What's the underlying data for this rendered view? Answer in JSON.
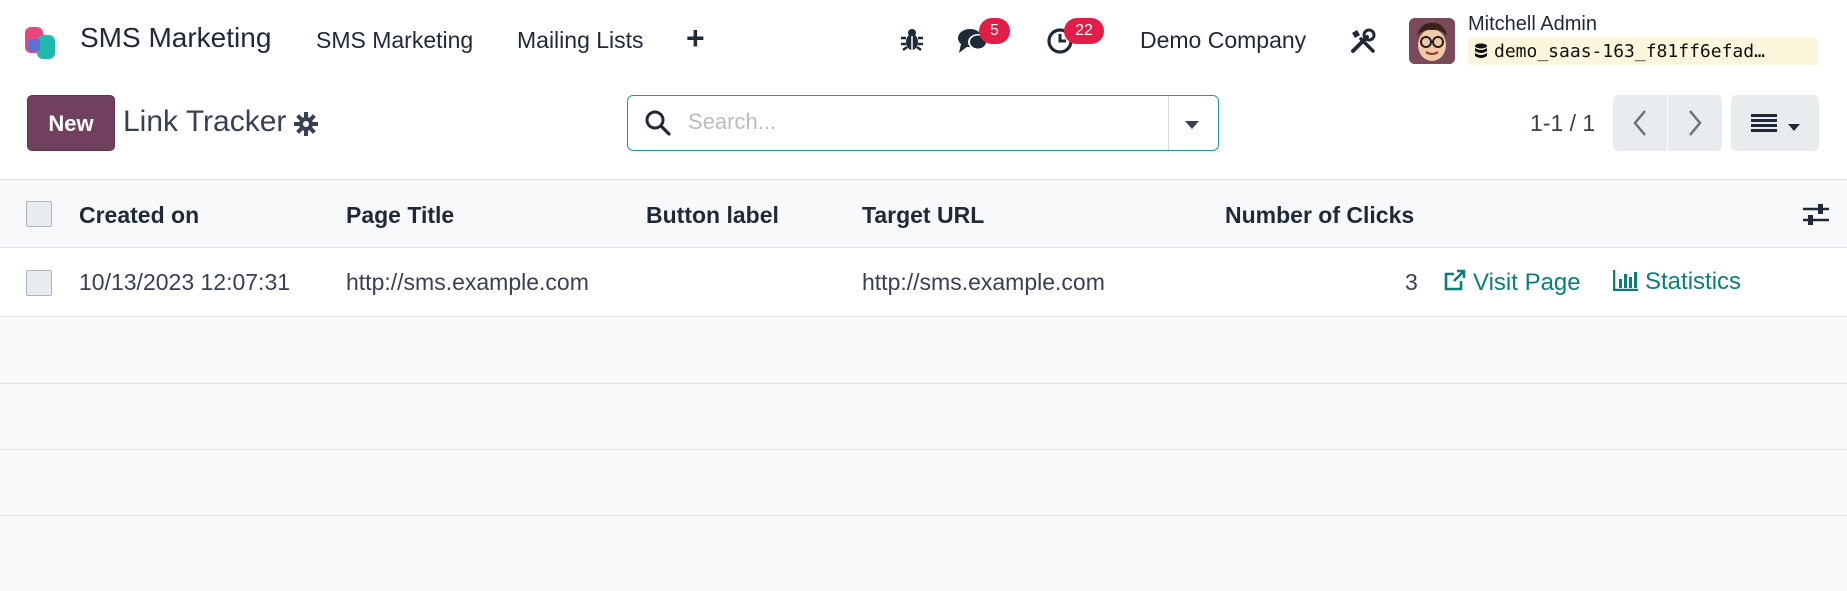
{
  "navbar": {
    "app_name": "SMS Marketing",
    "menu": [
      "SMS Marketing",
      "Mailing Lists"
    ],
    "plus": "+",
    "messages_badge": "5",
    "activities_badge": "22",
    "company": "Demo Company",
    "user_name": "Mitchell Admin",
    "database": "demo_saas-163_f81ff6efad…",
    "icons": [
      "bug-icon",
      "chat-icon",
      "clock-icon",
      "tools-icon",
      "database-icon"
    ]
  },
  "control_panel": {
    "new_label": "New",
    "title": "Link Tracker",
    "search_placeholder": "Search...",
    "pager": "1-1 / 1"
  },
  "table": {
    "columns": [
      "Created on",
      "Page Title",
      "Button label",
      "Target URL",
      "Number of Clicks"
    ],
    "rows": [
      {
        "created_on": "10/13/2023 12:07:31",
        "page_title": "http://sms.example.com",
        "button_label": "",
        "target_url": "http://sms.example.com",
        "clicks": "3",
        "visit_label": "Visit Page",
        "stats_label": "Statistics"
      }
    ]
  },
  "colors": {
    "primary": "#71405f",
    "accent": "#0b7e7a",
    "badge": "#e11d48",
    "search_border": "#1a9c97"
  }
}
